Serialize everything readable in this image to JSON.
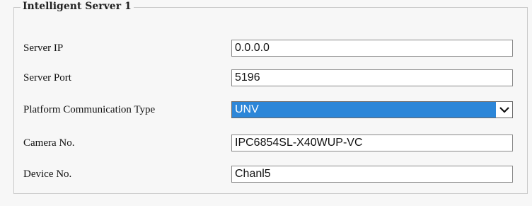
{
  "group": {
    "title": "Intelligent Server 1"
  },
  "fields": {
    "server_ip": {
      "label": "Server IP",
      "value": "0.0.0.0"
    },
    "server_port": {
      "label": "Server Port",
      "value": "5196"
    },
    "platform_type": {
      "label": "Platform Communication Type",
      "value": "UNV",
      "icon": "chevron-down-icon"
    },
    "camera_no": {
      "label": "Camera No.",
      "value": "IPC6854SL-X40WUP-VC"
    },
    "device_no": {
      "label": "Device No.",
      "value": "Chanl5"
    }
  },
  "colors": {
    "selected_highlight": "#2c86d8",
    "background": "#f7f7f7",
    "border": "#c9c9c9"
  }
}
